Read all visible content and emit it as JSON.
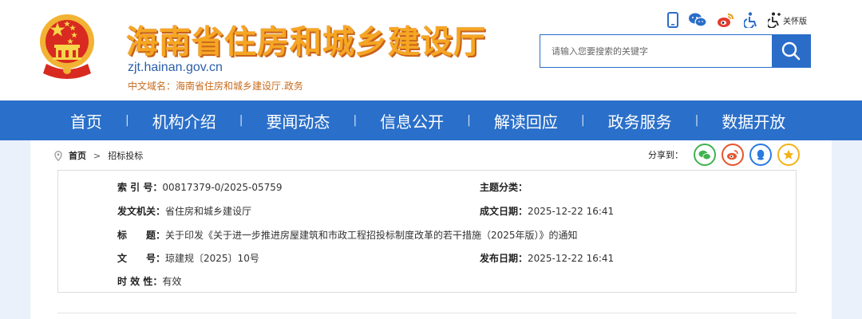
{
  "header": {
    "site_title": "海南省住房和城乡建设厅",
    "domain": "zjt.hainan.gov.cn",
    "cn_domain": "中文域名：海南省住房和城乡建设厅.政务",
    "care_mode_label": "关怀版",
    "search": {
      "placeholder": "请输入您要搜索的关键字"
    }
  },
  "nav": {
    "items": [
      "首页",
      "机构介绍",
      "要闻动态",
      "信息公开",
      "解读回应",
      "政务服务",
      "数据开放"
    ],
    "separator": "|"
  },
  "breadcrumb": {
    "home": "首页",
    "current": "招标投标"
  },
  "share": {
    "label": "分享到："
  },
  "meta": {
    "index_no": {
      "label": "索 引 号：",
      "value": "00817379-0/2025-05759"
    },
    "topic": {
      "label": "主题分类：",
      "value": ""
    },
    "issuer": {
      "label": "发文机关：",
      "value": "省住房和城乡建设厅"
    },
    "written_date": {
      "label": "成文日期：",
      "value": "2025-12-22 16:41"
    },
    "title": {
      "label": "标　　题：",
      "value": "关于印发《关于进一步推进房屋建筑和市政工程招投标制度改革的若干措施（2025年版）》的通知"
    },
    "doc_no": {
      "label": "文　　号：",
      "value": "琼建规〔2025〕10号"
    },
    "publish_date": {
      "label": "发布日期：",
      "value": "2025-12-22 16:41"
    },
    "validity": {
      "label": "时 效 性：",
      "value": "有效"
    }
  },
  "colors": {
    "nav_bg": "#2a6fc9",
    "title_orange": "#f5a623",
    "domain_blue": "#2b5fa8",
    "share_wechat": "#3fb34f",
    "share_weibo": "#e8542d",
    "share_qq": "#2a7be0",
    "share_qzone": "#f3b21a"
  },
  "icons": [
    "mobile-icon",
    "wechat-icon",
    "weibo-icon",
    "accessibility-icon",
    "care-mode-icon",
    "search-icon",
    "location-icon"
  ]
}
